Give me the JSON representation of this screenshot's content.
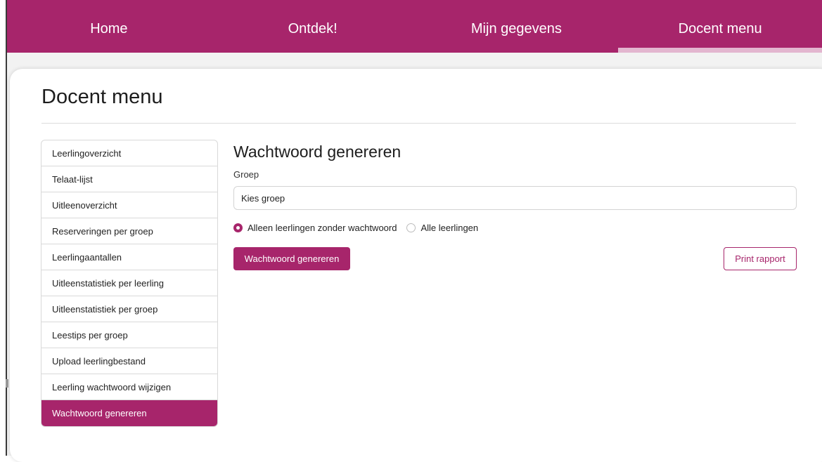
{
  "topnav": {
    "items": [
      {
        "label": "Home"
      },
      {
        "label": "Ontdek!"
      },
      {
        "label": "Mijn gegevens"
      },
      {
        "label": "Docent menu"
      }
    ]
  },
  "page": {
    "title": "Docent menu"
  },
  "sidebar": {
    "items": [
      {
        "label": "Leerlingoverzicht"
      },
      {
        "label": "Telaat-lijst"
      },
      {
        "label": "Uitleenoverzicht"
      },
      {
        "label": "Reserveringen per groep"
      },
      {
        "label": "Leerlingaantallen"
      },
      {
        "label": "Uitleenstatistiek per leerling"
      },
      {
        "label": "Uitleenstatistiek per groep"
      },
      {
        "label": "Leestips per groep"
      },
      {
        "label": "Upload leerlingbestand"
      },
      {
        "label": "Leerling wachtwoord wijzigen"
      },
      {
        "label": "Wachtwoord genereren"
      }
    ],
    "active_index": 10
  },
  "content": {
    "title": "Wachtwoord genereren",
    "group_label": "Groep",
    "group_select_value": "Kies groep",
    "radio_options": [
      {
        "label": "Alleen leerlingen zonder wachtwoord",
        "checked": true
      },
      {
        "label": "Alle leerlingen",
        "checked": false
      }
    ],
    "generate_button": "Wachtwoord genereren",
    "print_button": "Print rapport"
  },
  "colors": {
    "brand": "#a7256b",
    "active_underline": "#e3b6cf"
  }
}
